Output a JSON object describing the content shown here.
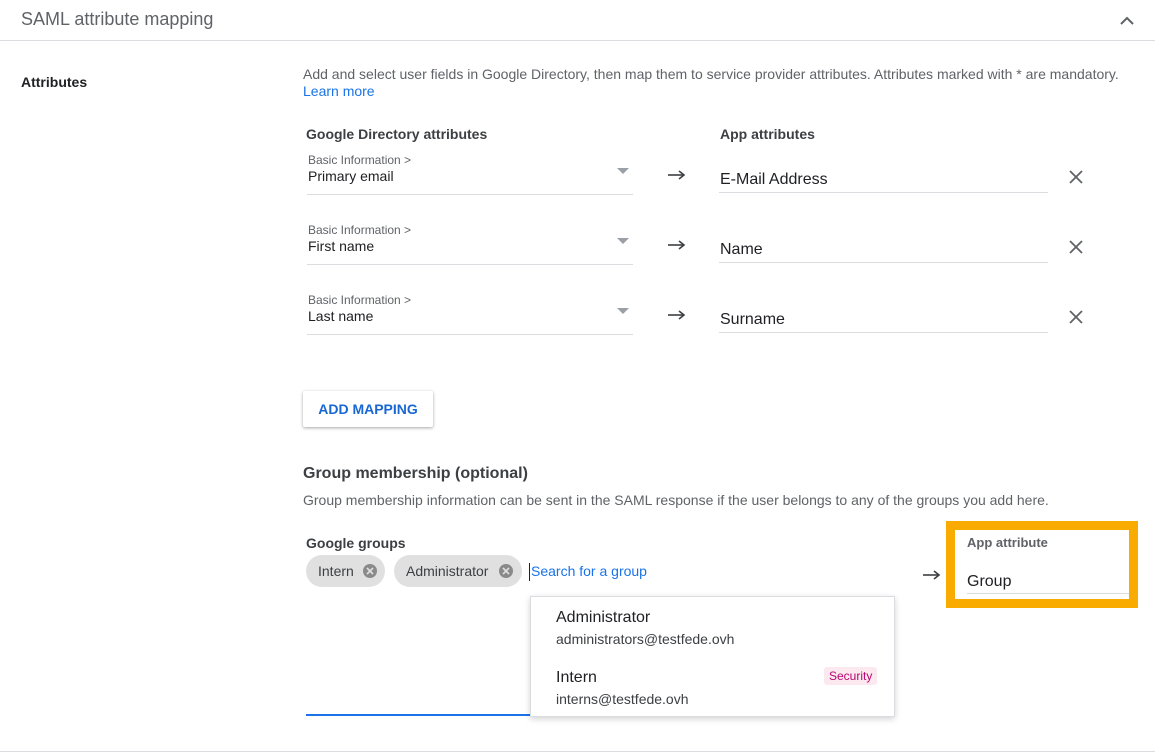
{
  "header": {
    "title": "SAML attribute mapping",
    "collapse_icon": "chevron-up-icon"
  },
  "section": {
    "label": "Attributes",
    "description": "Add and select user fields in Google Directory, then map them to service provider attributes. Attributes marked with * are mandatory.",
    "learn_more": "Learn more"
  },
  "columns": {
    "directory": "Google Directory attributes",
    "app": "App attributes"
  },
  "mappings": [
    {
      "category": "Basic Information >",
      "directory_field": "Primary email",
      "app_attribute": "E-Mail Address"
    },
    {
      "category": "Basic Information >",
      "directory_field": "First name",
      "app_attribute": "Name"
    },
    {
      "category": "Basic Information >",
      "directory_field": "Last name",
      "app_attribute": "Surname"
    }
  ],
  "add_mapping_label": "ADD MAPPING",
  "group_membership": {
    "title": "Group membership (optional)",
    "description": "Group membership information can be sent in the SAML response if the user belongs to any of the groups you add here.",
    "groups_label": "Google groups",
    "chips": [
      {
        "label": "Intern"
      },
      {
        "label": "Administrator"
      }
    ],
    "search_placeholder": "Search for a group",
    "app_attribute_label": "App attribute",
    "app_attribute_value": "Group",
    "highlight_color": "#f9ab00"
  },
  "dropdown_options": [
    {
      "name": "Administrator",
      "email": "administrators@testfede.ovh",
      "badge": ""
    },
    {
      "name": "Intern",
      "email": "interns@testfede.ovh",
      "badge": "Security"
    }
  ]
}
